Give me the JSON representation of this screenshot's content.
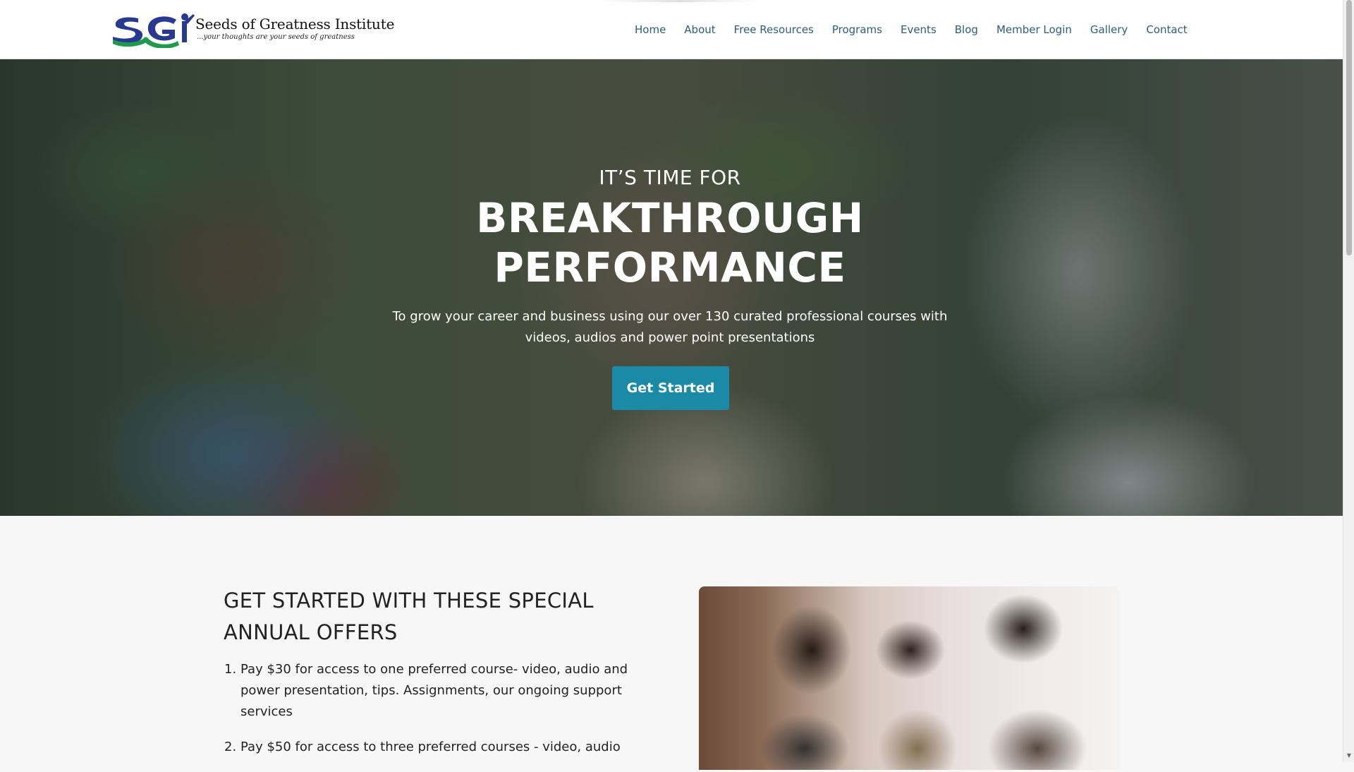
{
  "header": {
    "logo": {
      "mark_text": "SGI",
      "name": "Seeds of Greatness Institute",
      "tagline": "...your thoughts are your seeds of greatness"
    },
    "nav": [
      {
        "label": "Home"
      },
      {
        "label": "About"
      },
      {
        "label": "Free Resources"
      },
      {
        "label": "Programs"
      },
      {
        "label": "Events"
      },
      {
        "label": "Blog"
      },
      {
        "label": "Member Login"
      },
      {
        "label": "Gallery"
      },
      {
        "label": "Contact"
      }
    ]
  },
  "hero": {
    "eyebrow": "IT’S TIME FOR",
    "title_line1": "BREAKTHROUGH",
    "title_line2": "PERFORMANCE",
    "subtitle_line1": "To grow your career and business using our over 130 curated professional courses with",
    "subtitle_line2": "videos, audios and power point presentations",
    "cta_label": "Get Started"
  },
  "offers": {
    "title_line1": "GET STARTED WITH THESE SPECIAL",
    "title_line2": "ANNUAL OFFERS",
    "items": [
      {
        "num": "1.",
        "line1": "Pay $30 for access to one preferred course- video, audio and",
        "line2": "power presentation, tips. Assignments, our ongoing support",
        "line3": "services"
      },
      {
        "num": "2.",
        "line1": "Pay $50 for access to three preferred courses - video, audio"
      }
    ]
  },
  "colors": {
    "nav_text": "#2b5e7f",
    "cta_bg": "#1b8aa6",
    "logo_blue": "#283a8f",
    "logo_green": "#1f9a4a"
  }
}
